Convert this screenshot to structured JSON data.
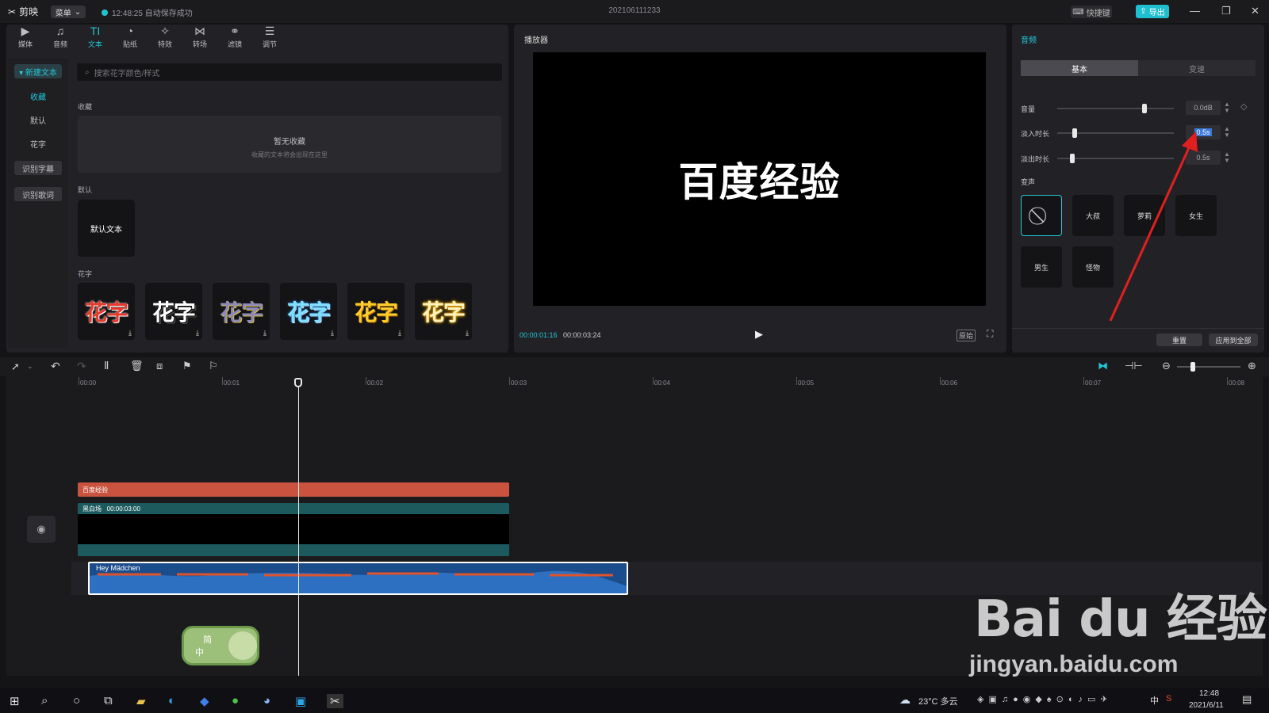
{
  "app": {
    "name": "剪映",
    "menu": "菜单",
    "autosave": "12:48:25 自动保存成功",
    "project": "202106111233",
    "shortcut": "快捷键",
    "export": "导出"
  },
  "toolbar": {
    "items": [
      {
        "label": "媒体",
        "icon": "media-icon"
      },
      {
        "label": "音频",
        "icon": "audio-icon"
      },
      {
        "label": "文本",
        "icon": "text-icon"
      },
      {
        "label": "贴纸",
        "icon": "sticker-icon"
      },
      {
        "label": "特效",
        "icon": "effects-icon"
      },
      {
        "label": "转场",
        "icon": "transition-icon"
      },
      {
        "label": "滤镜",
        "icon": "filter-icon"
      },
      {
        "label": "调节",
        "icon": "adjust-icon"
      }
    ]
  },
  "sidebar": {
    "new_text": "▾ 新建文本",
    "fav": "收藏",
    "default": "默认",
    "flower": "花字",
    "recognize_sub": "识别字幕",
    "recognize_lyrics": "识别歌词"
  },
  "library": {
    "search_placeholder": "搜索花字颜色/样式",
    "fav_title": "收藏",
    "empty_title": "暂无收藏",
    "empty_sub": "收藏的文本将会出现在这里",
    "default_title": "默认",
    "default_tile": "默认文本",
    "flower_title": "花字",
    "flower_tile": "花字"
  },
  "player": {
    "title": "播放器",
    "caption": "百度经验",
    "time_current": "00:00:01:16",
    "time_total": "00:00:03:24",
    "ratio": "原始"
  },
  "audio_panel": {
    "title": "音频",
    "tab_basic": "基本",
    "tab_speed": "变速",
    "volume_label": "音量",
    "volume_value": "0.0dB",
    "fadein_label": "淡入时长",
    "fadein_value": "0.5s",
    "fadeout_label": "淡出时长",
    "fadeout_value": "0.5s",
    "voice_label": "变声",
    "voices": [
      "大叔",
      "萝莉",
      "女生",
      "男生",
      "怪物"
    ],
    "reset": "重置",
    "apply_all": "应用到全部"
  },
  "timeline": {
    "ticks": [
      "00:00",
      "00:01",
      "00:02",
      "00:03",
      "00:04",
      "00:05",
      "00:06",
      "00:07",
      "00:08"
    ],
    "text_clip": "百度经验",
    "video_clip": "黑白场",
    "video_duration": "00:00:03:00",
    "audio_clip": "Hey Mädchen"
  },
  "ime": {
    "line1": "简",
    "line2": "中"
  },
  "taskbar": {
    "weather": "23°C 多云",
    "time": "12:48",
    "date": "2021/6/11",
    "ime": "中"
  },
  "watermark": {
    "brand": "Bai du 经验",
    "url": "jingyan.baidu.com"
  }
}
